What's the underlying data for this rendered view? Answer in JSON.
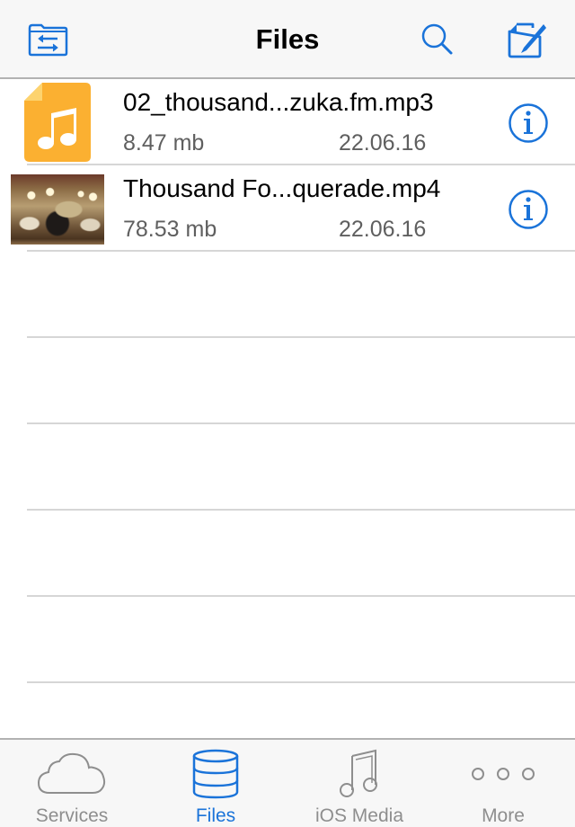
{
  "navbar": {
    "title": "Files",
    "left_icon": "folder-transfer-icon",
    "search_icon": "search-icon",
    "compose_icon": "compose-edit-icon",
    "accent": "#1a73d9"
  },
  "files": [
    {
      "name": "02_thousand...zuka.fm.mp3",
      "size": "8.47 mb",
      "date": "22.06.16",
      "thumbnail": "music-file-icon",
      "thumb_color": "#fbb031"
    },
    {
      "name": "Thousand Fo...querade.mp4",
      "size": "78.53 mb",
      "date": "22.06.16",
      "thumbnail": "video-thumbnail"
    }
  ],
  "tabbar": {
    "tabs": [
      {
        "label": "Services",
        "icon": "cloud-icon",
        "active": false
      },
      {
        "label": "Files",
        "icon": "database-icon",
        "active": true
      },
      {
        "label": "iOS Media",
        "icon": "music-note-icon",
        "active": false
      },
      {
        "label": "More",
        "icon": "more-dots-icon",
        "active": false
      }
    ]
  }
}
